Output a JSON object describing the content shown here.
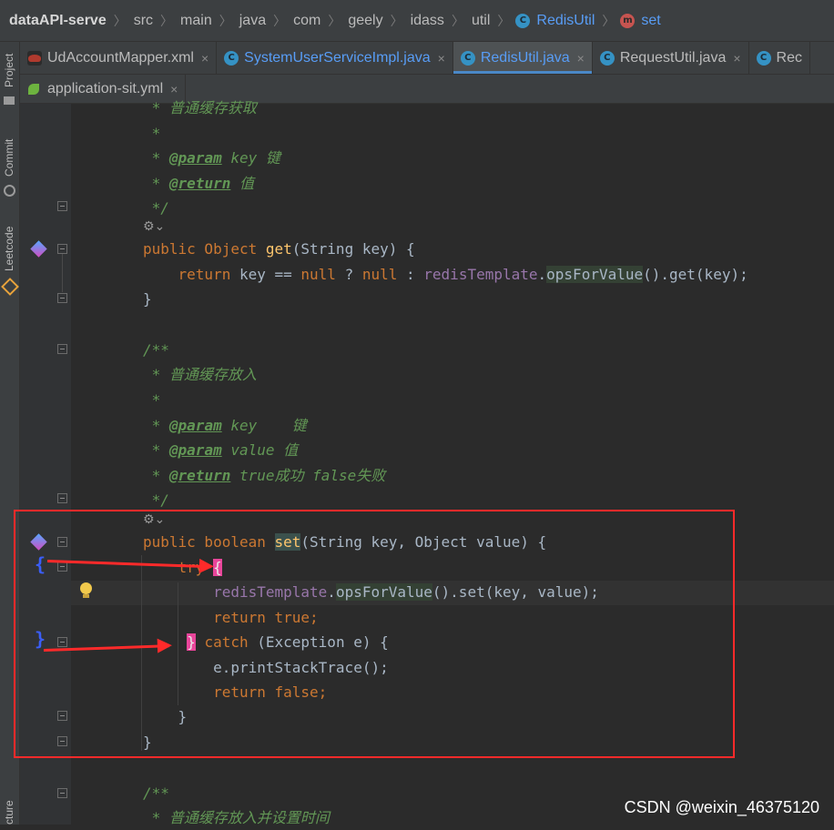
{
  "breadcrumb": {
    "project": "dataAPI-serve",
    "path": [
      "src",
      "main",
      "java",
      "com",
      "geely",
      "idass",
      "util"
    ],
    "class_name": "RedisUtil",
    "method_name": "set"
  },
  "sidebar": {
    "project": "Project",
    "commit": "Commit",
    "leetcode": "Leetcode",
    "structure": "cture"
  },
  "tabs_row1": [
    {
      "label": "UdAccountMapper.xml",
      "icon": "mybatis-xml-icon"
    },
    {
      "label": "SystemUserServiceImpl.java",
      "icon": "java-class-icon"
    },
    {
      "label": "RedisUtil.java",
      "icon": "java-class-icon",
      "active": true
    },
    {
      "label": "RequestUtil.java",
      "icon": "java-class-icon"
    },
    {
      "label": "Rec",
      "icon": "java-class-icon"
    }
  ],
  "tabs_row2": [
    {
      "label": "application-sit.yml",
      "icon": "spring-yml-icon"
    }
  ],
  "close_glyph": "×",
  "code": {
    "l1": " * 普通缓存获取",
    "star": " *",
    "param_tag": "@param",
    "return_tag": "@return",
    "l3_key": " key 键",
    "l4_val": " 值",
    "end_comment": " */",
    "get_sig_a": "public Object ",
    "get_sig_fn": "get",
    "get_sig_b": "(String key) {",
    "get_ret_a": "    return ",
    "get_ret_b": "key == ",
    "get_ret_null1": "null",
    "get_ret_c": " ? ",
    "get_ret_null2": "null",
    "get_ret_d": " : ",
    "get_ret_fld": "redisTemplate",
    "get_ret_e": ".",
    "get_ret_ofv": "opsForValue",
    "get_ret_f": "().get(key);",
    "close_brace": "}",
    "doc_open": "/**",
    "l13": " * 普通缓存放入",
    "l15_key": " key    键",
    "l16_val": " value 值",
    "l17_ret": " true成功 false失败",
    "set_sig_pub": "public boolean ",
    "set_sig_fn": "set",
    "set_sig_b": "(String key, Object value) {",
    "try_kw": "try",
    "open_brace": "{",
    "set_call_fld": "redisTemplate",
    "set_call_a": ".",
    "set_call_ofv": "opsForValue",
    "set_call_b": "().set(key, value);",
    "return_kw": "return ",
    "true_kw": "true",
    "semi": ";",
    "catch_close": "}",
    "catch_kw": " catch",
    "catch_b": " (Exception e) {",
    "print_stack": "e.printStackTrace();",
    "false_kw": "false",
    "l30": " * 普通缓存放入并设置时间"
  },
  "lambda_glyph": "⚙⌄",
  "gutter_brace_open": "{",
  "gutter_brace_close": "}",
  "watermark": "CSDN @weixin_46375120",
  "colors": {
    "highlight_box": "#ff2a2a",
    "brace_marker": "#3b5ef7",
    "matching_brace": "#e8459a"
  }
}
